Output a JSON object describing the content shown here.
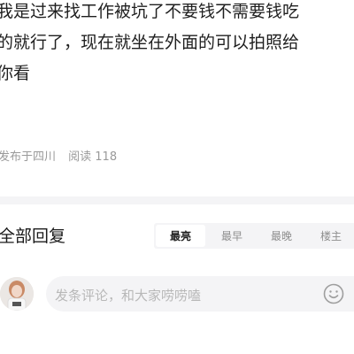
{
  "post": {
    "lines": [
      "我是过来找工作被坑了不要钱不需要钱吃",
      "的就行了，现在就坐在外面的可以拍照给",
      "你看"
    ]
  },
  "meta": {
    "location": "发布于四川",
    "reads": "阅读 118"
  },
  "replies": {
    "title": "全部回复",
    "tabs": [
      {
        "label": "最亮",
        "active": true
      },
      {
        "label": "最早",
        "active": false
      },
      {
        "label": "最晚",
        "active": false
      },
      {
        "label": "楼主",
        "active": false
      }
    ]
  },
  "comment_input": {
    "placeholder": "发条评论，和大家唠唠嗑",
    "emoji_icon": "smiley-face-icon"
  },
  "colors": {
    "background": "#ffffff",
    "muted_text": "#9a9a9a",
    "panel_gray": "#f4f4f6",
    "placeholder": "#b8b8b8"
  }
}
